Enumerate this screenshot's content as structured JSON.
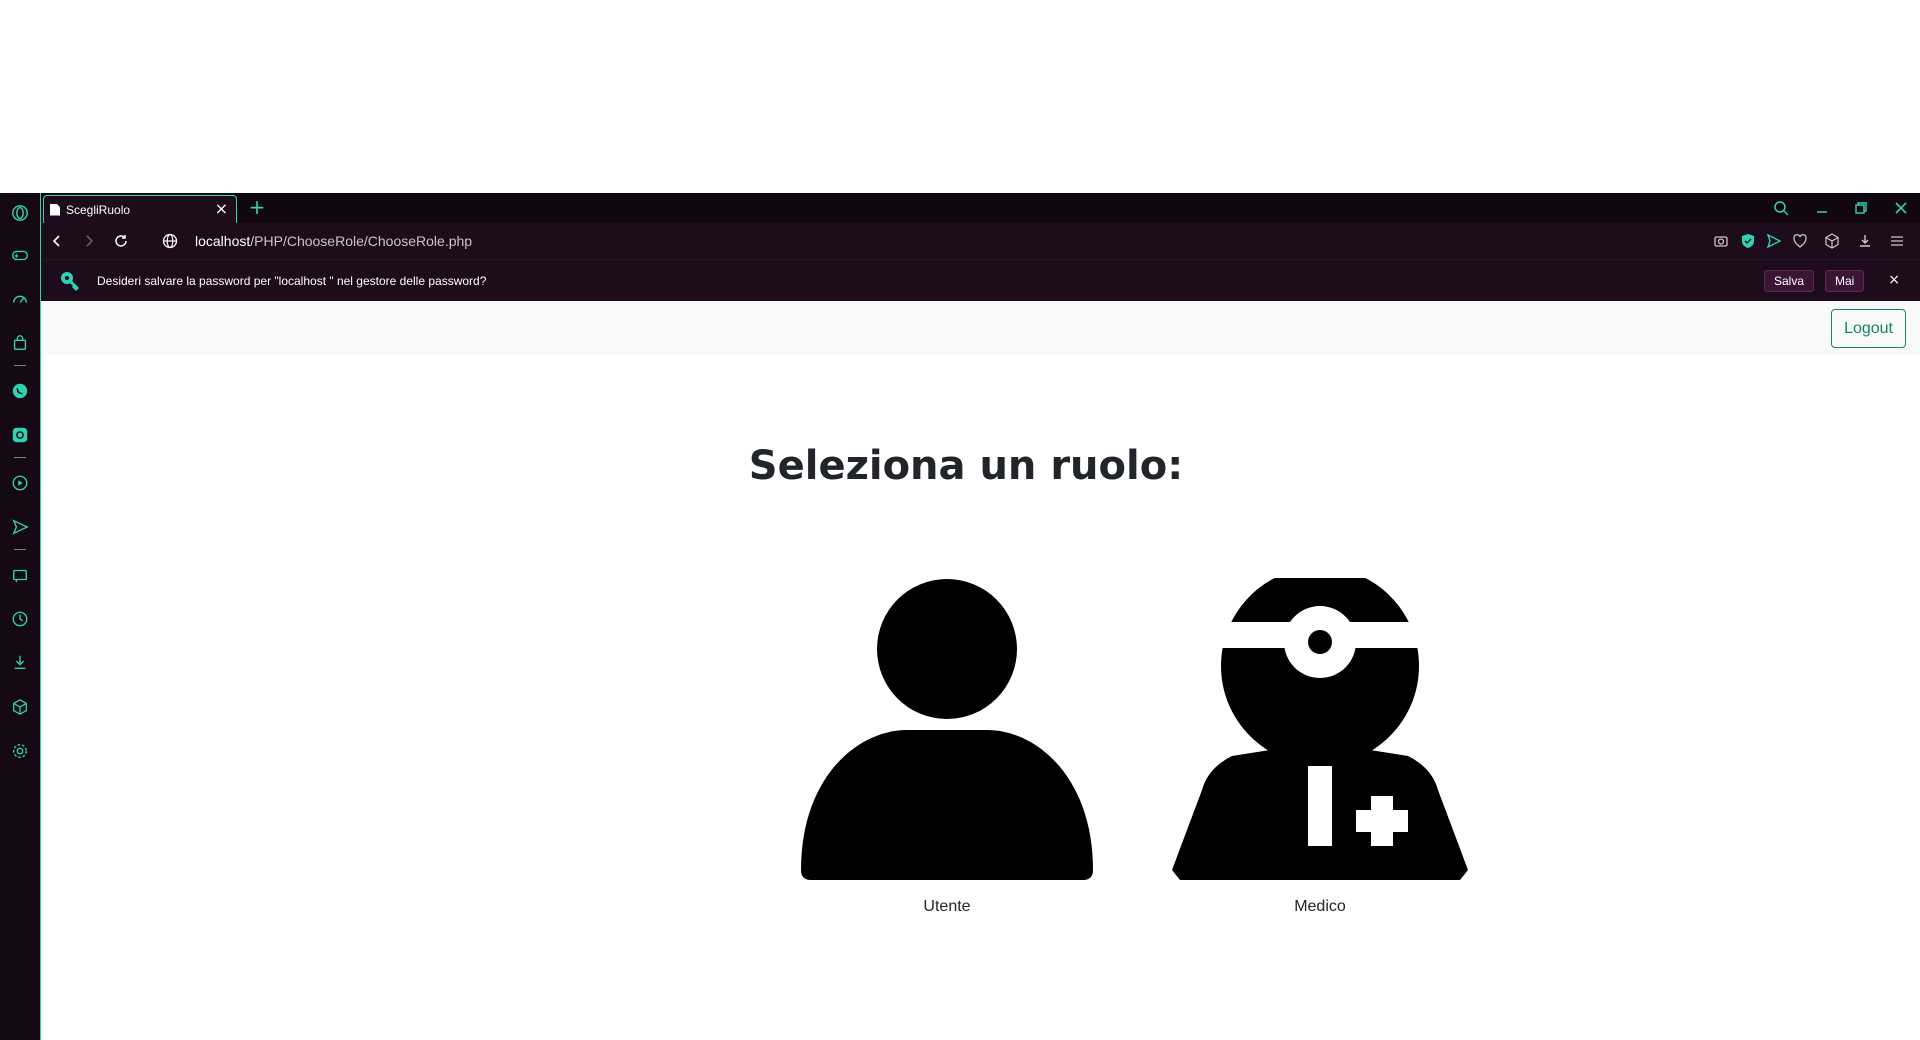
{
  "browser": {
    "tab_title": "ScegliRuolo",
    "url_host": "localhost",
    "url_path": "/PHP/ChooseRole/ChooseRole.php",
    "password_prompt": "Desideri salvare la password per \"localhost \" nel gestore delle password?",
    "save_label": "Salva",
    "never_label": "Mai",
    "accent_color": "#2fd3b3"
  },
  "navbar": {
    "logout_label": "Logout"
  },
  "main": {
    "title": "Seleziona un ruolo:",
    "roles": [
      {
        "label": "Utente",
        "icon": "user-icon"
      },
      {
        "label": "Medico",
        "icon": "doctor-icon"
      }
    ]
  }
}
